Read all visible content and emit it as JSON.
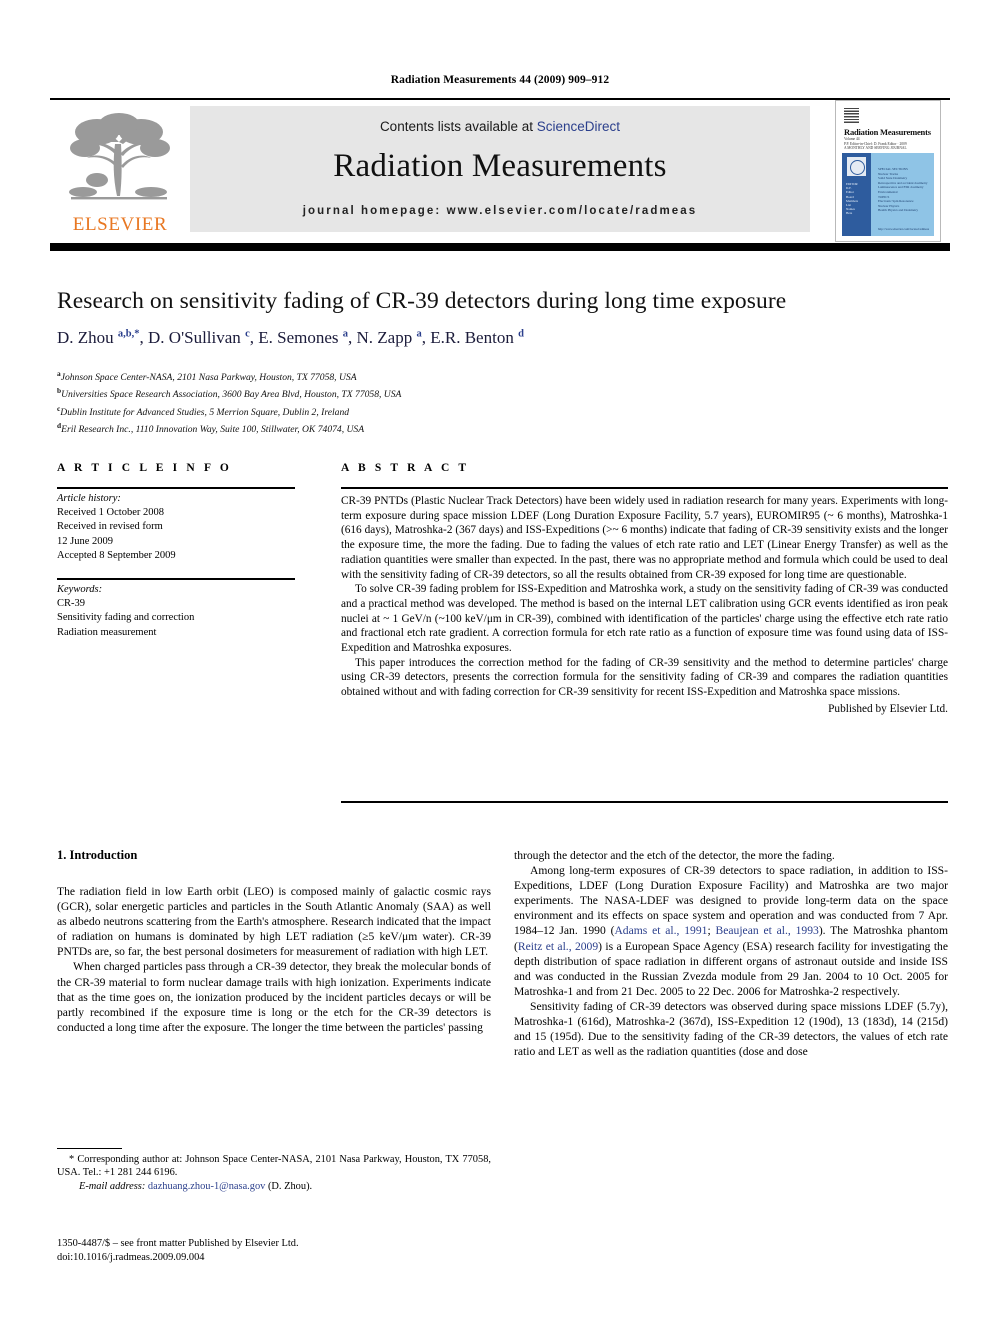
{
  "running_head": "Radiation Measurements 44 (2009) 909–912",
  "masthead": {
    "publisher_name": "ELSEVIER",
    "contents_prefix": "Contents lists available at ",
    "sciencedirect": "ScienceDirect",
    "journal_title": "Radiation Measurements",
    "journal_homepage": "journal homepage: www.elsevier.com/locate/radmeas",
    "cover": {
      "title": "Radiation Measurements",
      "subtitle": "Volume 44\nP.P. Editor-in-Chief: D. Frank Editor · 2009\nA MONTHLY AND SERVING JOURNAL",
      "left_panel_lines": "EDITOR\nD.F.\nEditor\nBoard\nMembers\nList\nNames\nHere",
      "right_panel_lines": "SPECIAL SECTIONS\nNuclear Tracks\nSolid State Dosimetry\nRetrospective and accident dosimetry\nLuminescence and ESR dosimetry\nEnvironmental\nTOPICS\nElectronic Spin Resonance\nNuclear Physics\nHealth Physics and Dosimetry",
      "url": "http://www.elsevier.com/locate/radmeas"
    }
  },
  "article": {
    "title": "Research on sensitivity fading of CR-39 detectors during long time exposure",
    "authors_html": "D. Zhou <sup>a,b,</sup><sup>*</sup>, D. O'Sullivan <sup>c</sup>, E. Semones <sup>a</sup>, N. Zapp <sup>a</sup>, E.R. Benton <sup>d</sup>",
    "affiliations": [
      {
        "mark": "a",
        "text": "Johnson Space Center-NASA, 2101 Nasa Parkway, Houston, TX 77058, USA"
      },
      {
        "mark": "b",
        "text": "Universities Space Research Association, 3600 Bay Area Blvd, Houston, TX 77058, USA"
      },
      {
        "mark": "c",
        "text": "Dublin Institute for Advanced Studies, 5 Merrion Square, Dublin 2, Ireland"
      },
      {
        "mark": "d",
        "text": "Eril Research Inc., 1110 Innovation Way, Suite 100, Stillwater, OK 74074, USA"
      }
    ]
  },
  "article_info": {
    "heading": "A R T I C L E   I N F O",
    "history_label": "Article history:",
    "history_lines": [
      "Received 1 October 2008",
      "Received in revised form",
      "12 June 2009",
      "Accepted 8 September 2009"
    ],
    "keywords_label": "Keywords:",
    "keywords": [
      "CR-39",
      "Sensitivity fading and correction",
      "Radiation measurement"
    ]
  },
  "abstract": {
    "heading": "A B S T R A C T",
    "paragraphs": [
      "CR-39 PNTDs (Plastic Nuclear Track Detectors) have been widely used in radiation research for many years. Experiments with long-term exposure during space mission LDEF (Long Duration Exposure Facility, 5.7 years), EUROMIR95 (~ 6 months), Matroshka-1 (616 days), Matroshka-2 (367 days) and ISS-Expeditions (>~ 6 months) indicate that fading of CR-39 sensitivity exists and the longer the exposure time, the more the fading. Due to fading the values of etch rate ratio and LET (Linear Energy Transfer) as well as the radiation quantities were smaller than expected. In the past, there was no appropriate method and formula which could be used to deal with the sensitivity fading of CR-39 detectors, so all the results obtained from CR-39 exposed for long time are questionable.",
      "To solve CR-39 fading problem for ISS-Expedition and Matroshka work, a study on the sensitivity fading of CR-39 was conducted and a practical method was developed. The method is based on the internal LET calibration using GCR events identified as iron peak nuclei at ~ 1 GeV/n (~100 keV/μm in CR-39), combined with identification of the particles' charge using the effective etch rate ratio and fractional etch rate gradient. A correction formula for etch rate ratio as a function of exposure time was found using data of ISS-Expedition and Matroshka exposures.",
      "This paper introduces the correction method for the fading of CR-39 sensitivity and the method to determine particles' charge using CR-39 detectors, presents the correction formula for the sensitivity fading of CR-39 and compares the radiation quantities obtained without and with fading correction for CR-39 sensitivity for recent ISS-Expedition and Matroshka space missions."
    ],
    "published_by": "Published by Elsevier Ltd."
  },
  "body": {
    "section_title": "1. Introduction",
    "left_paragraphs": [
      "The radiation field in low Earth orbit (LEO) is composed mainly of galactic cosmic rays (GCR), solar energetic particles and particles in the South Atlantic Anomaly (SAA) as well as albedo neutrons scattering from the Earth's atmosphere. Research indicated that the impact of radiation on humans is dominated by high LET radiation (≥5 keV/μm water). CR-39 PNTDs are, so far, the best personal dosimeters for measurement of radiation with high LET.",
      "When charged particles pass through a CR-39 detector, they break the molecular bonds of the CR-39 material to form nuclear damage trails with high ionization. Experiments indicate that as the time goes on, the ionization produced by the incident particles decays or will be partly recombined if the exposure time is long or the etch for the CR-39 detectors is conducted a long time after the exposure. The longer the time between the particles' passing"
    ],
    "right_paragraphs": [
      "through the detector and the etch of the detector, the more the fading.",
      "Among long-term exposures of CR-39 detectors to space radiation, in addition to ISS-Expeditions, LDEF (Long Duration Exposure Facility) and Matroshka are two major experiments. The NASA-LDEF was designed to provide long-term data on the space environment and its effects on space system and operation and was conducted from 7 Apr. 1984–12 Jan. 1990 (Adams et al., 1991; Beaujean et al., 1993). The Matroshka phantom (Reitz et al., 2009) is a European Space Agency (ESA) research facility for investigating the depth distribution of space radiation in different organs of astronaut outside and inside ISS and was conducted in the Russian Zvezda module from 29 Jan. 2004 to 10 Oct. 2005 for Matroshka-1 and from 21 Dec. 2005 to 22 Dec. 2006 for Matroshka-2 respectively.",
      "Sensitivity fading of CR-39 detectors was observed during space missions LDEF (5.7y), Matroshka-1 (616d), Matroshka-2 (367d), ISS-Expedition 12 (190d), 13 (183d), 14 (215d) and 15 (195d). Due to the sensitivity fading of the CR-39 detectors, the values of etch rate ratio and LET as well as the radiation quantities (dose and dose"
    ],
    "citations": [
      "Adams et al., 1991",
      "Beaujean et al., 1993",
      "Reitz et al., 2009"
    ]
  },
  "footnotes": {
    "corresponding": "* Corresponding author at: Johnson Space Center-NASA, 2101 Nasa Parkway, Houston, TX 77058, USA. Tel.: +1 281 244 6196.",
    "email_label": "E-mail address:",
    "email": "dazhuang.zhou-1@nasa.gov",
    "email_suffix": " (D. Zhou).",
    "front_matter": "1350-4487/$ – see front matter Published by Elsevier Ltd.",
    "doi": "doi:10.1016/j.radmeas.2009.09.004"
  },
  "colors": {
    "accent_orange": "#E87722",
    "link_navy": "#2b3f8c",
    "masthead_grey": "#e6e6e6"
  }
}
